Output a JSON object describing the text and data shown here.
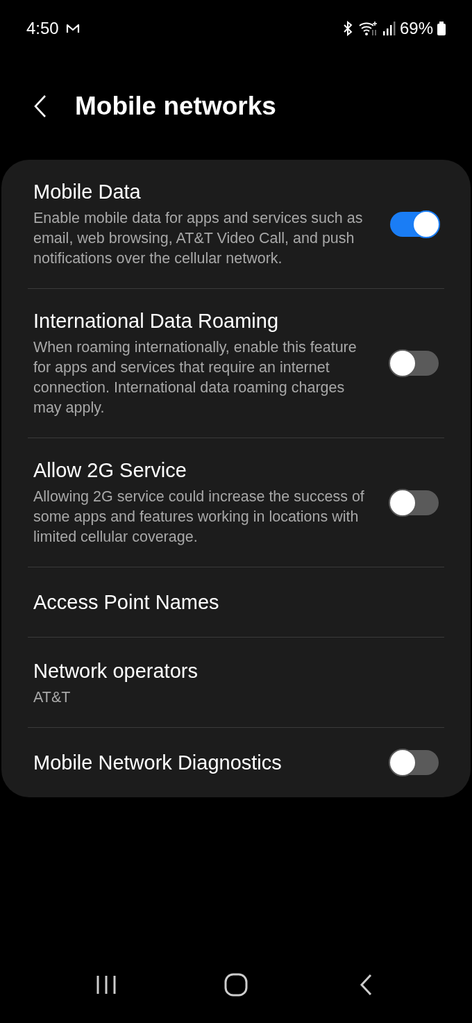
{
  "status_bar": {
    "time": "4:50",
    "battery": "69%"
  },
  "header": {
    "title": "Mobile networks"
  },
  "items": [
    {
      "kind": "toggle",
      "title": "Mobile Data",
      "subtitle": "Enable mobile data for apps and services such as email, web browsing, AT&T Video Call, and push notifications over the cellular network.",
      "on": true
    },
    {
      "kind": "toggle",
      "title": "International Data Roaming",
      "subtitle": "When roaming internationally, enable this feature for apps and services that require an internet connection. International data roaming charges may apply.",
      "on": false
    },
    {
      "kind": "toggle",
      "title": "Allow 2G Service",
      "subtitle": "Allowing 2G service could increase the success of some apps and features working in locations with limited cellular coverage.",
      "on": false
    },
    {
      "kind": "link",
      "title": "Access Point Names"
    },
    {
      "kind": "link",
      "title": "Network operators",
      "subtitle": "AT&T"
    },
    {
      "kind": "toggle",
      "title": "Mobile Network Diagnostics",
      "on": false
    }
  ]
}
